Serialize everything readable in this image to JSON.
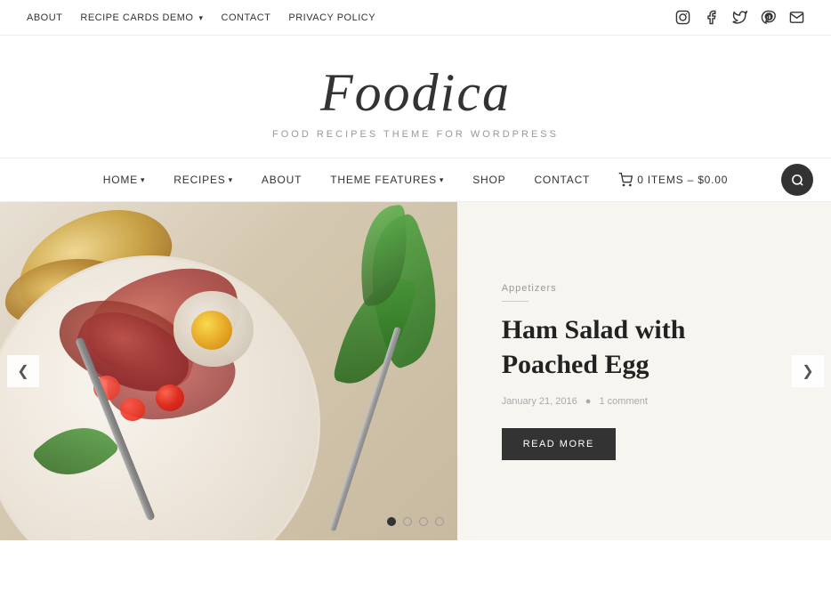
{
  "topNav": {
    "items": [
      {
        "label": "ABOUT",
        "hasDropdown": false
      },
      {
        "label": "RECIPE CARDS DEMO",
        "hasDropdown": true
      },
      {
        "label": "CONTACT",
        "hasDropdown": false
      },
      {
        "label": "PRIVACY POLICY",
        "hasDropdown": false
      }
    ]
  },
  "socialIcons": [
    {
      "name": "instagram-icon",
      "glyph": "⬜"
    },
    {
      "name": "facebook-icon",
      "glyph": "f"
    },
    {
      "name": "twitter-icon",
      "glyph": "🐦"
    },
    {
      "name": "pinterest-icon",
      "glyph": "P"
    },
    {
      "name": "email-icon",
      "glyph": "✉"
    }
  ],
  "branding": {
    "title": "Foodica",
    "subtitle": "FOOD RECIPES THEME FOR WORDPRESS"
  },
  "mainNav": {
    "items": [
      {
        "label": "HOME",
        "hasDropdown": true
      },
      {
        "label": "RECIPES",
        "hasDropdown": true
      },
      {
        "label": "ABOUT",
        "hasDropdown": false
      },
      {
        "label": "THEME FEATURES",
        "hasDropdown": true
      },
      {
        "label": "SHOP",
        "hasDropdown": false
      },
      {
        "label": "CONTACT",
        "hasDropdown": false
      }
    ],
    "cart": {
      "label": "0 ITEMS – $0.00"
    }
  },
  "hero": {
    "slide": {
      "category": "Appetizers",
      "title": "Ham Salad with Poached Egg",
      "date": "January 21, 2016",
      "comments": "1 comment",
      "readMore": "READ MORE"
    },
    "dots": [
      {
        "active": true
      },
      {
        "active": false
      },
      {
        "active": false
      },
      {
        "active": false
      }
    ],
    "prevArrow": "❮",
    "nextArrow": "❯"
  }
}
